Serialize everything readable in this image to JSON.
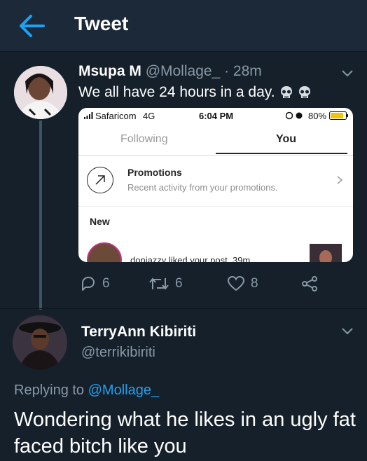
{
  "header": {
    "title": "Tweet",
    "back_icon": "back-arrow-icon",
    "accent": "#1da1f2"
  },
  "tweet1": {
    "name": "Msupa M",
    "handle": "@Mollage_",
    "dot": "·",
    "time": "28m",
    "text": "We all have 24 hours in a day.",
    "emoji_icon": "skull-icon",
    "actions": {
      "replies": "6",
      "retweets": "6",
      "likes": "8"
    },
    "screenshot": {
      "carrier": "Safaricom",
      "network": "4G",
      "clock": "6:04 PM",
      "battery": "80%",
      "tabs": [
        "Following",
        "You"
      ],
      "promo_title": "Promotions",
      "promo_subtitle": "Recent activity from your promotions.",
      "section_label": "New",
      "notification": "doniazzy liked your post. 39m"
    }
  },
  "tweet2": {
    "name": "TerryAnn Kibiriti",
    "handle": "@terrikibiriti",
    "reply_prefix": "Replying to",
    "reply_handle": "@Mollage_",
    "text": "Wondering what he likes in an ugly fat faced bitch like you"
  }
}
